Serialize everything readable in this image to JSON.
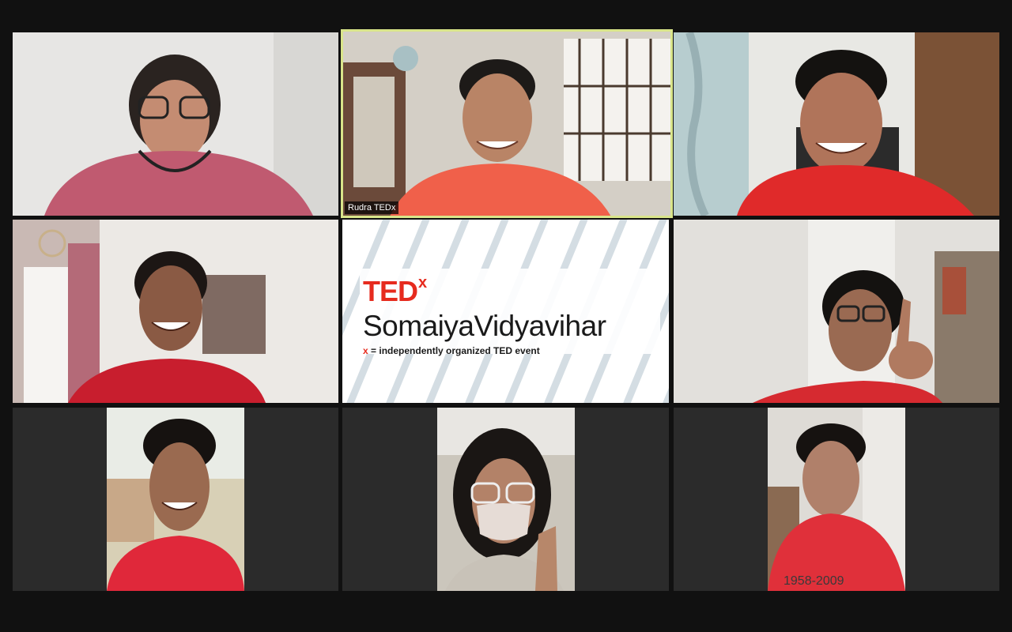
{
  "participants": [
    {
      "id": "p1",
      "shirt_color": "#c05a70"
    },
    {
      "id": "p2",
      "name_label": "Rudra TEDx",
      "active_speaker": true,
      "shirt_color": "#f0604a"
    },
    {
      "id": "p3",
      "shirt_color": "#e02a2a"
    },
    {
      "id": "p4",
      "shirt_color": "#c81e2e"
    },
    {
      "id": "p6",
      "shirt_color": "#d62a30"
    },
    {
      "id": "p7",
      "shirt_color": "#e0283a"
    },
    {
      "id": "p8",
      "shirt_color": "#c8c2b8"
    },
    {
      "id": "p9",
      "shirt_color": "#e0303a",
      "shirt_text": "1958-2009"
    }
  ],
  "ted_card": {
    "brand": "TED",
    "brand_super": "x",
    "event_name": "SomaiyaVidyavihar",
    "tagline_x": "x",
    "tagline": " = independently organized TED event"
  },
  "colors": {
    "background": "#111111",
    "active_border": "#d9e58a",
    "ted_red": "#e62b1e"
  }
}
